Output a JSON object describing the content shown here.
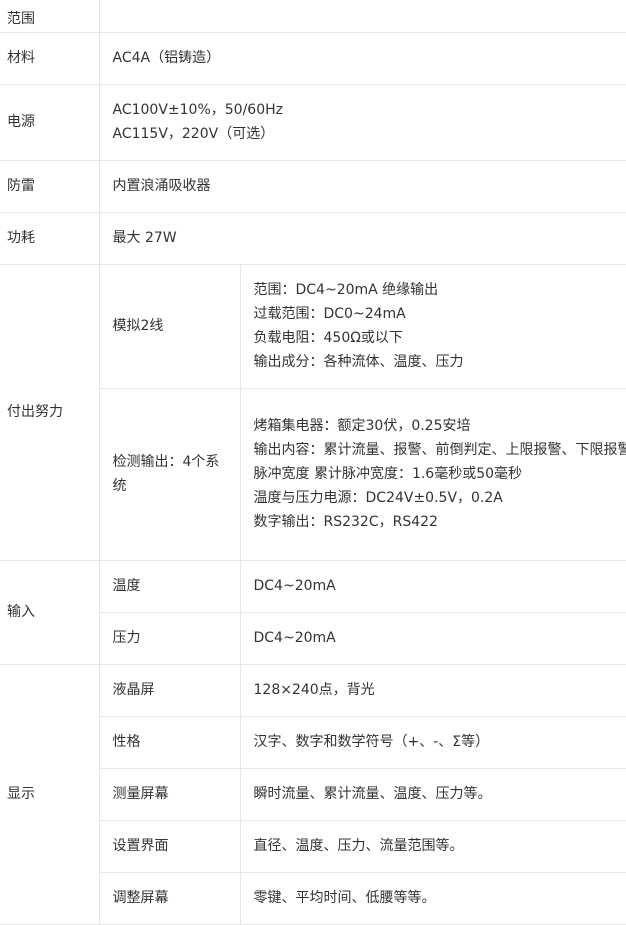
{
  "table": {
    "rows": [
      {
        "label": "范围",
        "value": ""
      },
      {
        "label": "材料",
        "value": "AC4A（铝铸造）"
      },
      {
        "label": "电源",
        "lines": [
          "AC100V±10%，50/60Hz",
          "AC115V，220V（可选）"
        ]
      },
      {
        "label": "防雷",
        "value": "内置浪涌吸收器"
      },
      {
        "label": "功耗",
        "value": "最大 27W"
      }
    ],
    "groups": [
      {
        "label": "付出努力",
        "items": [
          {
            "name": "模拟2线",
            "lines": [
              "范围：DC4~20mA 绝缘输出",
              "过载范围：DC0~24mA",
              "负载电阻：450Ω或以下",
              "输出成分：各种流体、温度、压力"
            ]
          },
          {
            "name": "检测输出：4个系统",
            "lines": [
              "烤箱集电器：额定30伏，0.25安培",
              "输出内容：累计流量、报警、前倒判定、上限报警、下限报警",
              "脉冲宽度 累计脉冲宽度：1.6毫秒或50毫秒",
              "温度与压力电源：DC24V±0.5V，0.2A",
              "数字输出：RS232C，RS422"
            ]
          }
        ]
      },
      {
        "label": "输入",
        "items": [
          {
            "name": "温度",
            "lines": [
              "DC4~20mA"
            ]
          },
          {
            "name": "压力",
            "lines": [
              "DC4~20mA"
            ]
          }
        ]
      },
      {
        "label": "显示",
        "items": [
          {
            "name": "液晶屏",
            "lines": [
              "128×240点，背光"
            ]
          },
          {
            "name": "性格",
            "lines": [
              "汉字、数字和数学符号（+、-、Σ等）"
            ]
          },
          {
            "name": "测量屏幕",
            "lines": [
              "瞬时流量、累计流量、温度、压力等。"
            ]
          },
          {
            "name": "设置界面",
            "lines": [
              "直径、温度、压力、流量范围等。"
            ]
          },
          {
            "name": "调整屏幕",
            "lines": [
              "零键、平均时间、低腰等等。"
            ]
          }
        ]
      }
    ]
  }
}
